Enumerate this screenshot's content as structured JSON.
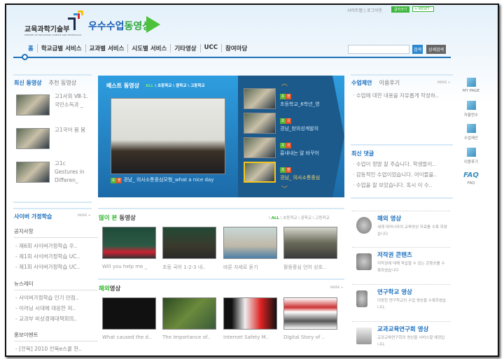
{
  "header": {
    "ministry": "교육과학기술부",
    "ministry_en": "MINISTRY OF EDUCATION, SCIENCE AND TECHNOLOGY",
    "site_title_a": "우수수업",
    "site_title_b": "동영상",
    "top_links": [
      "사이트맵",
      "로그아웃"
    ],
    "font_size_label": "글자크기",
    "reset_label": "+ RESET -"
  },
  "nav": {
    "items": [
      "홈",
      "학교급별 서비스",
      "교과별 서비스",
      "시도별 서비스",
      "기타영상",
      "UCC",
      "참여마당"
    ],
    "search_placeholder": "",
    "search_btn": "검색",
    "detail_search_btn": "상세검색"
  },
  "latest": {
    "tabs": [
      "최신 동영상",
      "추천 동영상"
    ],
    "items": [
      {
        "title": "고1사회 Ⅷ-1. 국민소득과 _"
      },
      {
        "title": "고1국어 봄 봄"
      },
      {
        "title": "고1c Gestures in Differen_"
      }
    ]
  },
  "best": {
    "title": "베스트 동영상",
    "filters": [
      "ALL",
      "초등학교",
      "중학교",
      "고등학교"
    ],
    "main": {
      "badges": [
        "초",
        "영"
      ],
      "caption": "경남_ 의사소통중심모형_what a nice day"
    },
    "list": [
      {
        "badges": [
          "초",
          "영"
        ],
        "title": "초등학교_6학년_영"
      },
      {
        "badges": [
          "초",
          "국"
        ],
        "title": "경남_창의성계발히"
      },
      {
        "badges": [
          "초",
          "국"
        ],
        "title": "흉내내는 말 바꾸어"
      },
      {
        "badges": [
          "초",
          "영"
        ],
        "title": "경남_ 의사소통중심"
      }
    ]
  },
  "proposal": {
    "tabs": [
      "수업제안",
      "이용후기"
    ],
    "more": "MORE +",
    "items": [
      "수업에 대한 내용을 자유롭게 작성하.."
    ]
  },
  "comments": {
    "title": "최신 댓글",
    "items": [
      "수업이 정말 잘 주습니다. 학생들이..",
      "감동적인 수업이었습니다. 아이들을..",
      "수업을 잘 보았습니다. 혹시 이 수.."
    ]
  },
  "quick": [
    {
      "label": "MY PAGE",
      "icon": "user-icon"
    },
    {
      "label": "자율연수",
      "icon": "bag-icon"
    },
    {
      "label": "수업제안",
      "icon": "board-icon"
    },
    {
      "label": "이용후기",
      "icon": "review-icon"
    },
    {
      "label": "FAQ",
      "icon": "faq-icon"
    }
  ],
  "cyber": {
    "title": "사이버 가정학습",
    "more": "MORE +",
    "notice_title": "공지사항",
    "notices": [
      "제6회 사이버가정학습 우..",
      "제1회 사이버가정학습 UC..",
      "제1회 사이버가정학습 UC.."
    ],
    "news_title": "뉴스레터",
    "news": [
      "사이버가정학습 인기 만점..",
      "이러닝 시대에 대응한 저..",
      "교과부 비상경제대책회의.."
    ],
    "event_title": "홍보이벤트",
    "events": [
      "[전북] 2010 전북e스쿨 한.."
    ]
  },
  "popular": {
    "title_a": "많이 본",
    "title_b": " 동영상",
    "filters": [
      "ALL",
      "초등학교",
      "중학교",
      "고등학교"
    ],
    "items": [
      "Will you help me _",
      "초등 국어 1-2-3 내..",
      "바른 자세로 듣기",
      "활동중심 언어 상호.."
    ]
  },
  "overseas": {
    "title_a": "해외",
    "title_b": "영상",
    "more": "MORE +",
    "items": [
      "What caused the d..",
      "The Importance of..",
      "Internet Safety M..",
      "Digital Story of .."
    ]
  },
  "services": [
    {
      "title": "해외 영상",
      "desc": "세계 여러나라의 교육영상 자료를 수록 하였습니다"
    },
    {
      "title": "저작권 콘텐츠",
      "desc": "저작권에 대해 학습할 수 있는 콘텐츠를 수록하였습니다"
    },
    {
      "title": "연구학교 영상",
      "desc": "다양한 연구학교의 수업 영상을 수록하였습니다."
    },
    {
      "title": "교과교육연구회 영상",
      "desc": "교과교육연구회의 영상을 서비스할 예정입니다."
    }
  ]
}
